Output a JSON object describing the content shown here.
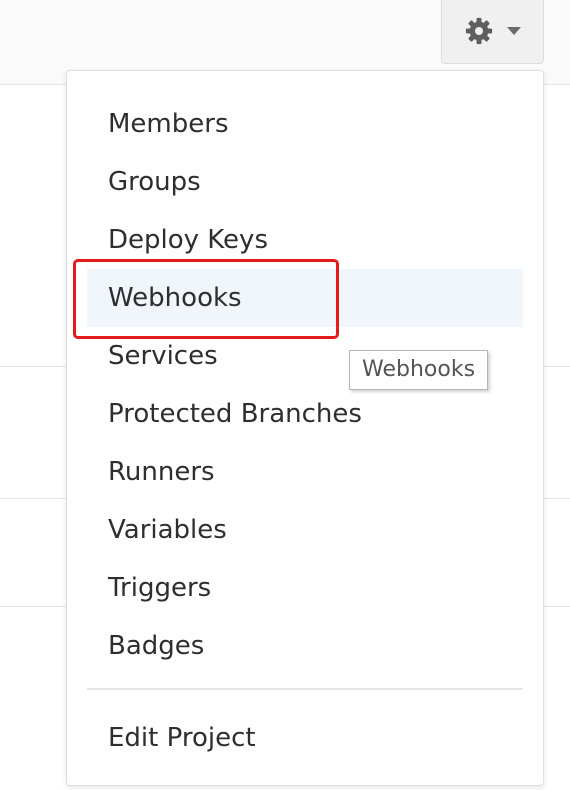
{
  "settings": {
    "icon": "gear-icon",
    "caret": "caret-down-icon"
  },
  "menu": {
    "items": [
      {
        "label": "Members"
      },
      {
        "label": "Groups"
      },
      {
        "label": "Deploy Keys"
      },
      {
        "label": "Webhooks",
        "state": "hovered"
      },
      {
        "label": "Services"
      },
      {
        "label": "Protected Branches"
      },
      {
        "label": "Runners"
      },
      {
        "label": "Variables"
      },
      {
        "label": "Triggers"
      },
      {
        "label": "Badges"
      }
    ],
    "footer_item": {
      "label": "Edit Project"
    }
  },
  "tooltip": {
    "text": "Webhooks"
  },
  "colors": {
    "highlight_border": "#e31b1b",
    "hover_background": "#f1f5fc",
    "text": "#2e2e2e"
  }
}
